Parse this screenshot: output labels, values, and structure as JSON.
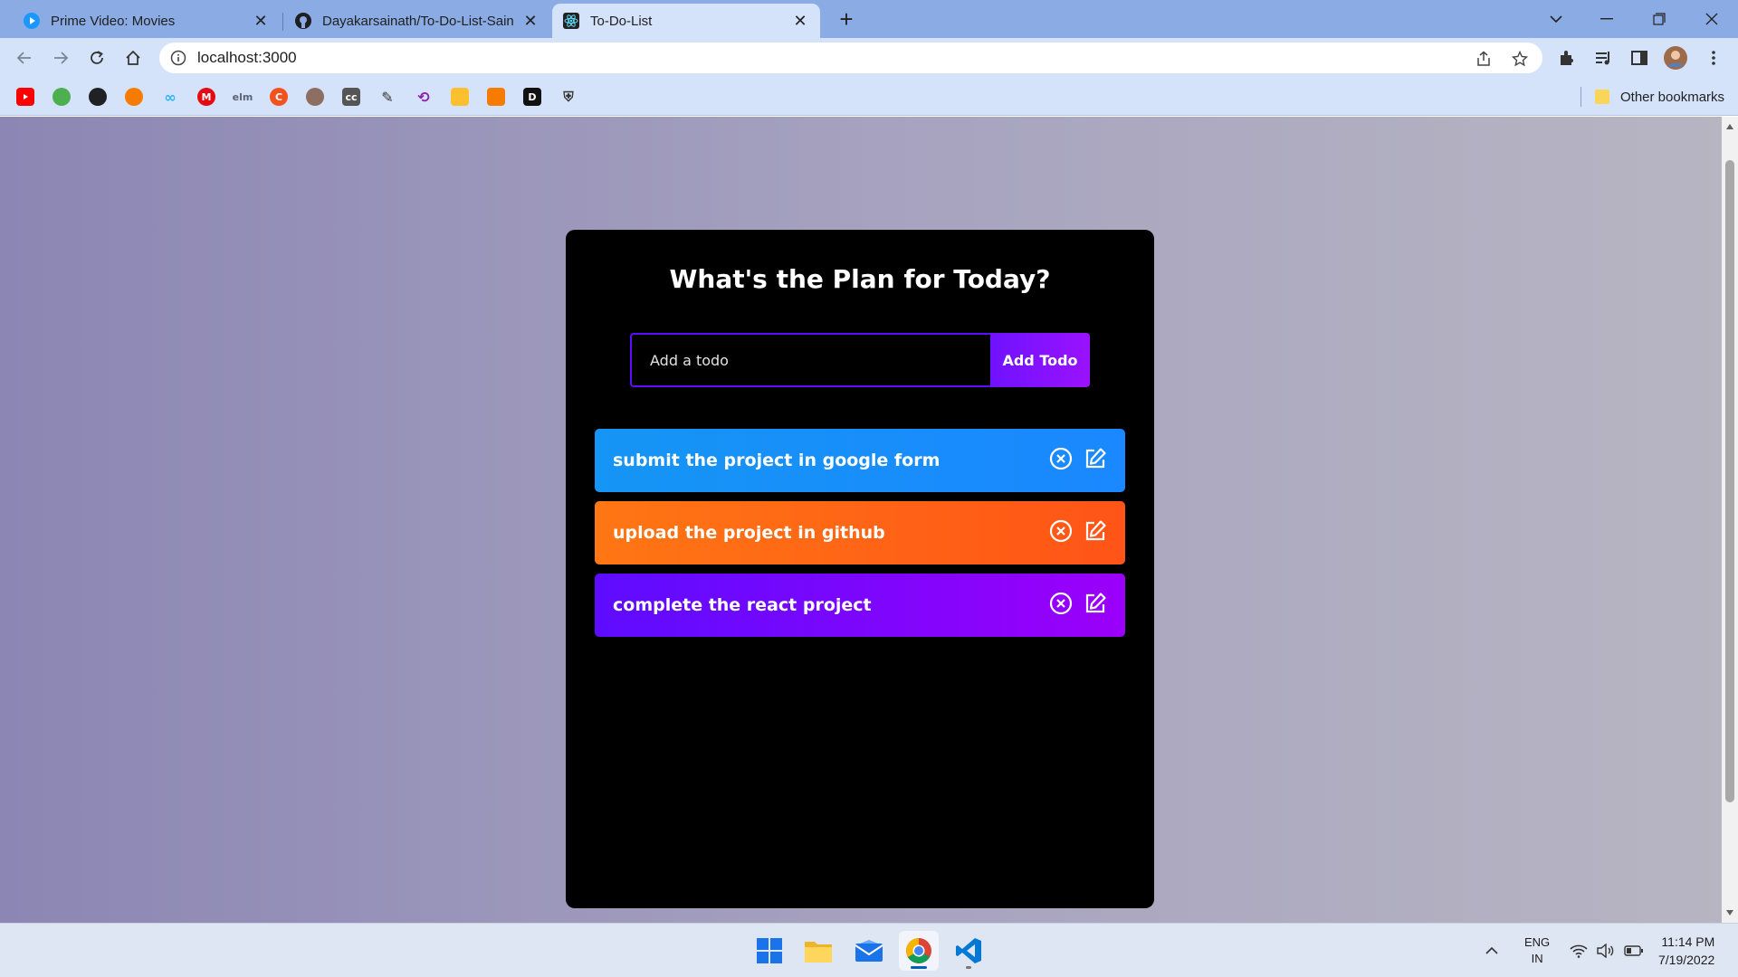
{
  "browser": {
    "tabs": [
      {
        "title": "Prime Video: Movies",
        "active": false
      },
      {
        "title": "Dayakarsainath/To-Do-List-Saina",
        "active": false
      },
      {
        "title": "To-Do-List",
        "active": true
      }
    ],
    "new_tab_glyph": "+",
    "close_glyph": "✕",
    "url": "localhost:3000",
    "bookmarks": [
      {
        "icon": "youtube-icon",
        "color": "#ff0000"
      },
      {
        "icon": "chrome-web-store-icon",
        "color": "#4caf50"
      },
      {
        "icon": "globe-icon",
        "color": "#202124"
      },
      {
        "icon": "sun-icon",
        "color": "#f57c00"
      },
      {
        "icon": "infinity-icon",
        "color": "#29b6f6"
      },
      {
        "icon": "m-letter-icon",
        "color": "#e50914"
      },
      {
        "icon": "elm-icon",
        "color": "#5a6378"
      },
      {
        "icon": "c-circle-icon",
        "color": "#f4511e"
      },
      {
        "icon": "avatar-icon",
        "color": "#8d6e63"
      },
      {
        "icon": "cc-icon",
        "color": "#555555"
      },
      {
        "icon": "pencil-icon",
        "color": "#333333"
      },
      {
        "icon": "replit-icon",
        "color": "#8e24aa"
      },
      {
        "icon": "cube-yellow-icon",
        "color": "#fbc02d"
      },
      {
        "icon": "cube-orange-icon",
        "color": "#f57c00"
      },
      {
        "icon": "d-letter-icon",
        "color": "#111111"
      },
      {
        "icon": "shield-icon",
        "color": "#333333"
      }
    ],
    "other_bookmarks_label": "Other bookmarks"
  },
  "app": {
    "heading": "What's the Plan for Today?",
    "input_placeholder": "Add a todo",
    "input_value": "",
    "add_button_label": "Add Todo",
    "todos": [
      {
        "text": "submit the project in google form",
        "color": "#1a8cf7"
      },
      {
        "text": "upload the project in github",
        "color": "#ff6216"
      },
      {
        "text": "complete the react project",
        "color": "#7c06fd"
      }
    ]
  },
  "taskbar": {
    "apps": [
      "windows-start-icon",
      "file-explorer-icon",
      "mail-icon",
      "chrome-icon",
      "vscode-icon"
    ],
    "language_line1": "ENG",
    "language_line2": "IN",
    "time": "11:14 PM",
    "date": "7/19/2022"
  }
}
